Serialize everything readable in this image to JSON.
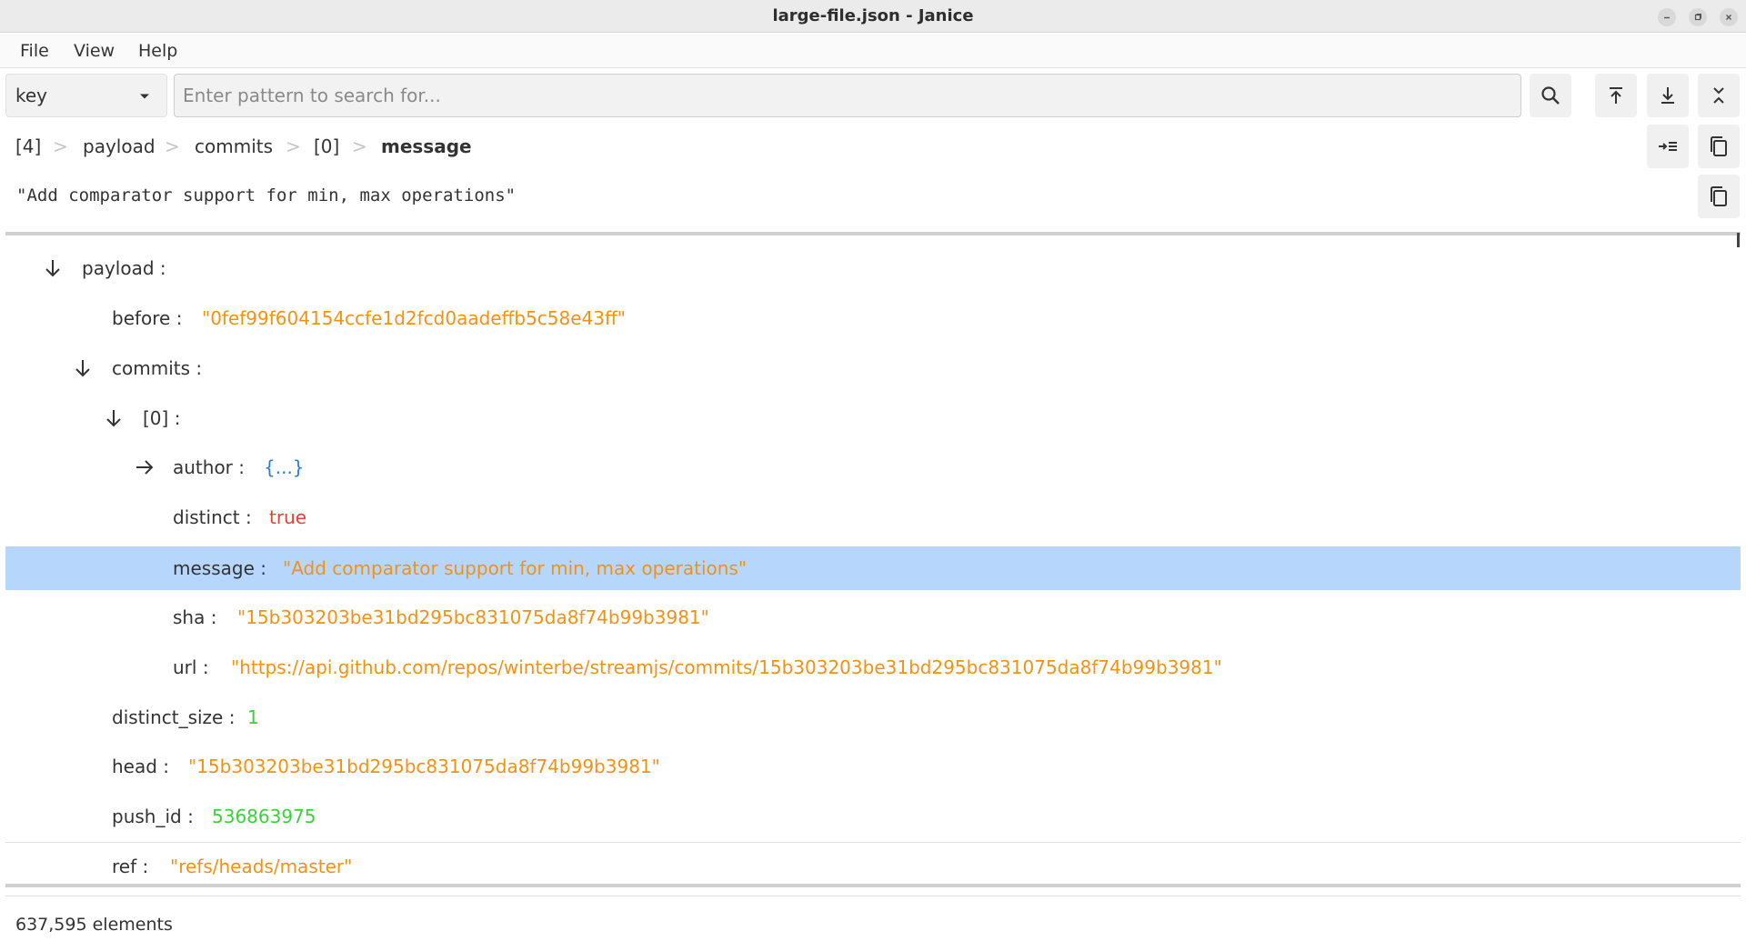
{
  "window": {
    "title": "large-file.json - Janice"
  },
  "menu": {
    "file": "File",
    "view": "View",
    "help": "Help"
  },
  "search": {
    "mode": "key",
    "placeholder": "Enter pattern to search for..."
  },
  "toolbar": {
    "icons": [
      "search-icon",
      "go-to-top-icon",
      "go-to-bottom-icon",
      "collapse-all-icon",
      "indent-icon",
      "copy-icon"
    ]
  },
  "breadcrumb": [
    {
      "label": "[4]"
    },
    {
      "label": "payload"
    },
    {
      "label": "commits"
    },
    {
      "label": "[0]"
    },
    {
      "label": "message"
    }
  ],
  "preview": {
    "value": "\"Add comparator support for min, max operations\""
  },
  "tree": {
    "rows": [
      {
        "key": "payload :",
        "arrow": "down",
        "value": ""
      },
      {
        "key": "before :",
        "value": "\"0fef99f604154ccfe1d2fcd0aadeffb5c58e43ff\"",
        "type": "string"
      },
      {
        "key": "commits :",
        "arrow": "down",
        "value": ""
      },
      {
        "key": "[0] :",
        "arrow": "down",
        "value": ""
      },
      {
        "key": "author :",
        "arrow": "right",
        "value": "{...}",
        "type": "object"
      },
      {
        "key": "distinct :",
        "value": "true",
        "type": "boolean"
      },
      {
        "key": "message :",
        "value": "\"Add comparator support for min, max operations\"",
        "type": "string",
        "selected": true
      },
      {
        "key": "sha :",
        "value": "\"15b303203be31bd295bc831075da8f74b99b3981\"",
        "type": "string"
      },
      {
        "key": "url :",
        "value": "\"https://api.github.com/repos/winterbe/streamjs/commits/15b303203be31bd295bc831075da8f74b99b3981\"",
        "type": "string"
      },
      {
        "key": "distinct_size :",
        "value": "1",
        "type": "number"
      },
      {
        "key": "head :",
        "value": "\"15b303203be31bd295bc831075da8f74b99b3981\"",
        "type": "string"
      },
      {
        "key": "push_id :",
        "value": "536863975",
        "type": "number"
      },
      {
        "key": "ref :",
        "value": "\"refs/heads/master\"",
        "type": "string"
      }
    ]
  },
  "status": {
    "count": "637,595 elements"
  },
  "colors": {
    "selection": "#b7d6fb",
    "string": "#f39212",
    "number": "#3bd13b",
    "boolean": "#ea3f35",
    "object": "#2b7fd9"
  }
}
